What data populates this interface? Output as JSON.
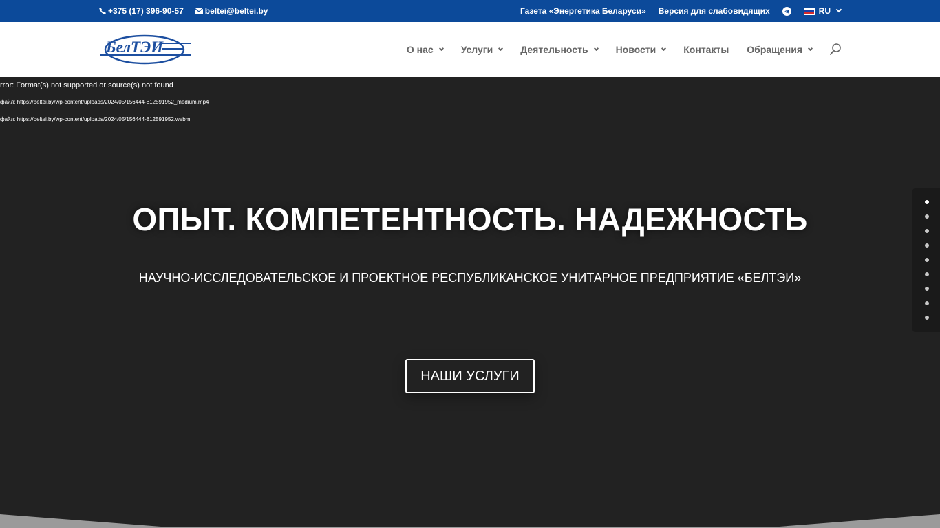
{
  "topbar": {
    "phone": "+375 (17) 396-90-57",
    "email": "beltei@beltei.by",
    "newspaper": "Газета «Энергетика Беларуси»",
    "accessibility": "Версия для слабовидящих",
    "lang": "RU"
  },
  "header": {
    "logo_text": "БелТЭИ",
    "nav": [
      {
        "label": "О нас"
      },
      {
        "label": "Услуги"
      },
      {
        "label": "Деятельность"
      },
      {
        "label": "Новости"
      },
      {
        "label": "Контакты"
      },
      {
        "label": "Обращения"
      }
    ]
  },
  "hero": {
    "error_line1": "rror: Format(s) not supported or source(s) not found",
    "error_line2": "файл: https://beltei.by/wp-content/uploads/2024/05/156444-812591952_medium.mp4",
    "error_line3": "файл: https://beltei.by/wp-content/uploads/2024/05/156444-812591952.webm",
    "title": "ОПЫТ. КОМПЕТЕНТНОСТЬ. НАДЕЖНОСТЬ",
    "subtitle": "НАУЧНО-ИССЛЕДОВАТЕЛЬСКОЕ И ПРОЕКТНОЕ РЕСПУБЛИКАНСКОЕ УНИТАРНОЕ ПРЕДПРИЯТИЕ «БЕЛТЭИ»",
    "button": "НАШИ УСЛУГИ"
  },
  "icons": {
    "phone": "phone-icon",
    "email": "envelope-icon",
    "telegram": "telegram-icon",
    "flag": "russia-flag-icon",
    "search": "search-icon"
  },
  "colors": {
    "topbar_bg": "#0c4a9a",
    "nav_text": "#666666",
    "hero_bg": "#222222",
    "logo_blue": "#1d4fa0"
  }
}
